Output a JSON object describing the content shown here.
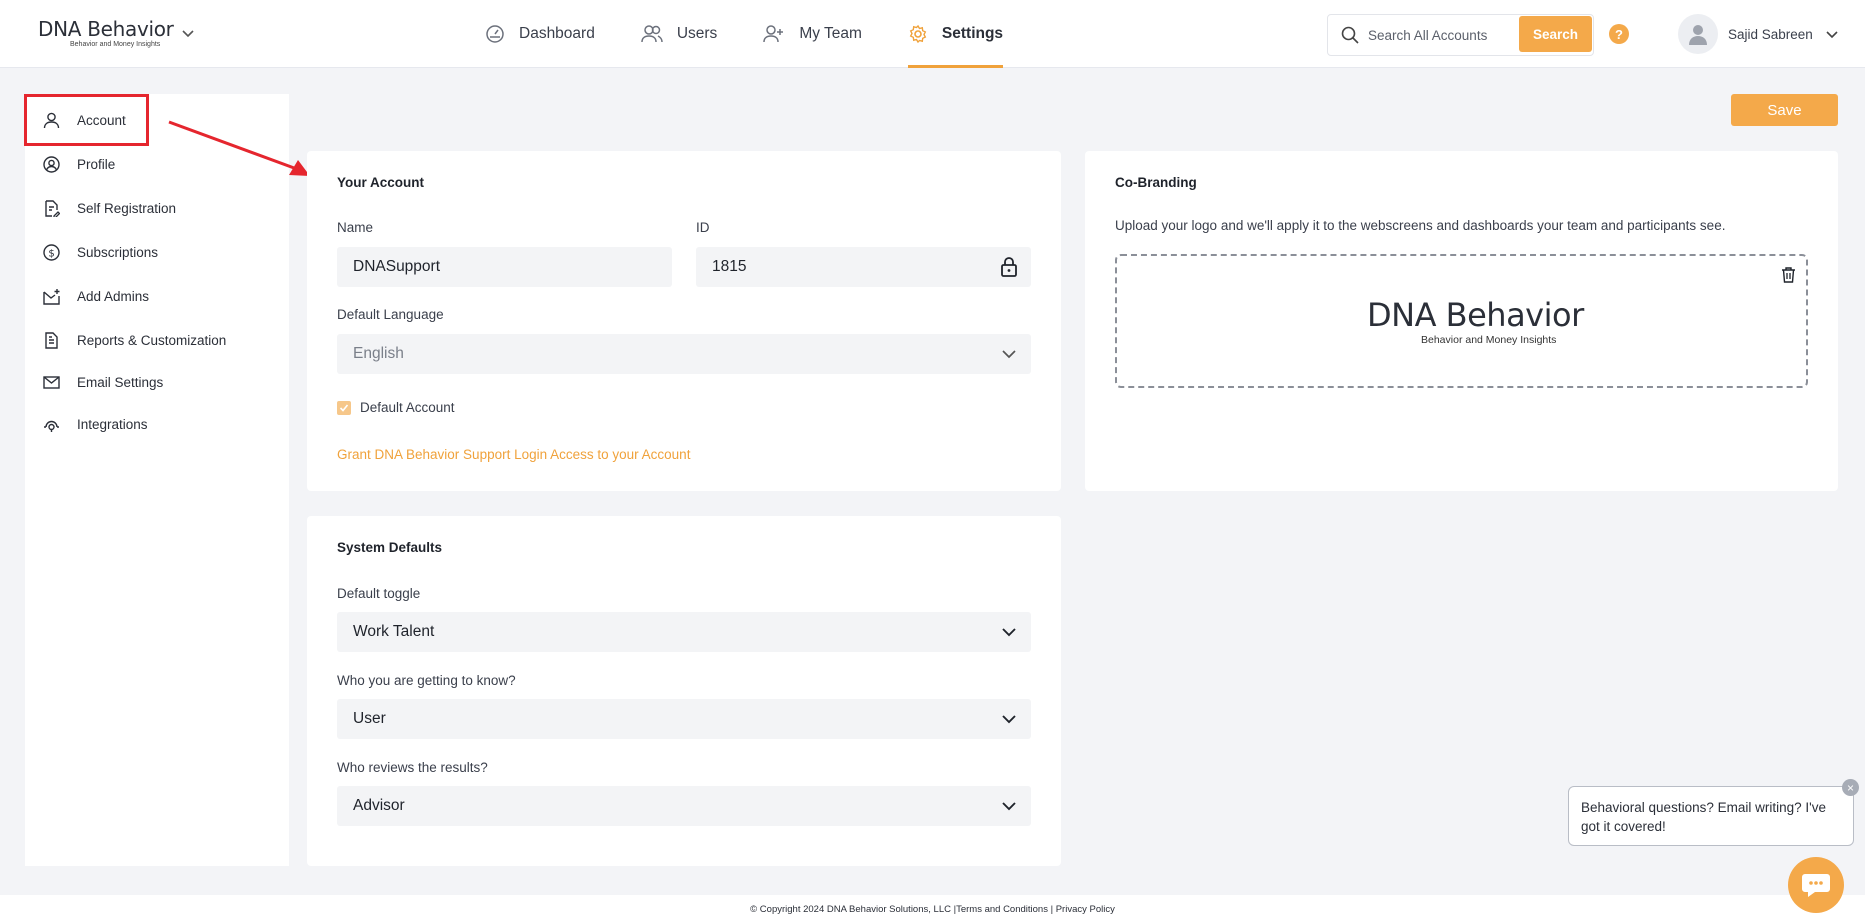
{
  "brand": {
    "logo_text": "DNA Behavior",
    "logo_tagline": "Behavior and Money Insights",
    "accent_color": "#f4a94a"
  },
  "nav": {
    "items": [
      {
        "label": "Dashboard",
        "icon": "dashboard-icon",
        "active": false
      },
      {
        "label": "Users",
        "icon": "users-icon",
        "active": false
      },
      {
        "label": "My Team",
        "icon": "add-user-icon",
        "active": false
      },
      {
        "label": "Settings",
        "icon": "gear-icon",
        "active": true
      }
    ]
  },
  "header": {
    "search_placeholder": "Search All Accounts",
    "search_button": "Search",
    "help_label": "?",
    "user_name": "Sajid Sabreen"
  },
  "sidebar": {
    "items": [
      {
        "label": "Account",
        "icon": "user-icon"
      },
      {
        "label": "Profile",
        "icon": "profile-circle-icon"
      },
      {
        "label": "Self Registration",
        "icon": "document-edit-icon"
      },
      {
        "label": "Subscriptions",
        "icon": "dollar-circle-icon"
      },
      {
        "label": "Add Admins",
        "icon": "inbox-add-icon"
      },
      {
        "label": "Reports & Customization",
        "icon": "report-icon"
      },
      {
        "label": "Email Settings",
        "icon": "mail-icon"
      },
      {
        "label": "Integrations",
        "icon": "integrations-icon"
      }
    ]
  },
  "actions": {
    "save_label": "Save"
  },
  "your_account": {
    "title": "Your Account",
    "name_label": "Name",
    "name_value": "DNASupport",
    "id_label": "ID",
    "id_value": "1815",
    "language_label": "Default Language",
    "language_value": "English",
    "default_account_label": "Default Account",
    "default_account_checked": true,
    "grant_link": "Grant DNA Behavior Support Login Access to your Account"
  },
  "co_branding": {
    "title": "Co-Branding",
    "description": "Upload your logo and we'll apply it to the webscreens and dashboards your team and participants see.",
    "logo_text": "DNA Behavior",
    "logo_tagline": "Behavior and Money Insights"
  },
  "system_defaults": {
    "title": "System Defaults",
    "default_toggle_label": "Default toggle",
    "default_toggle_value": "Work Talent",
    "getting_to_know_label": "Who you are getting to know?",
    "getting_to_know_value": "User",
    "reviews_label": "Who reviews the results?",
    "reviews_value": "Advisor"
  },
  "footer": {
    "copyright": "© Copyright 2024 DNA Behavior Solutions, LLC |",
    "terms": "Terms and Conditions",
    "separator": " | ",
    "privacy": "Privacy Policy"
  },
  "chat": {
    "message": "Behavioral questions? Email writing? I've got it covered!",
    "close": "×"
  }
}
